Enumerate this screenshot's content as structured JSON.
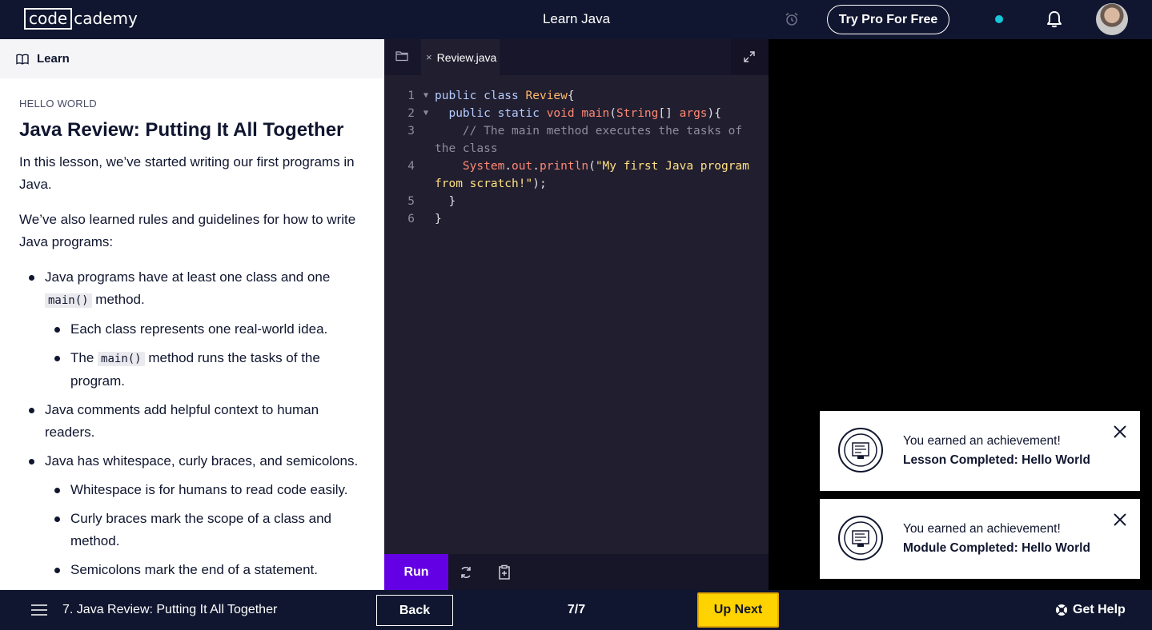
{
  "header": {
    "logo_left": "code",
    "logo_right": "cademy",
    "course_title": "Learn Java",
    "pro_button": "Try Pro For Free"
  },
  "learn": {
    "tab_label": "Learn",
    "eyebrow": "HELLO WORLD",
    "title": "Java Review: Putting It All Together",
    "para1": "In this lesson, we’ve started writing our first programs in Java.",
    "para2": "We’ve also learned rules and guidelines for how to write Java programs:",
    "b1_pre": "Java programs have at least one class and one ",
    "b1_code": "main()",
    "b1_post": " method.",
    "b1a": "Each class represents one real-world idea.",
    "b1b_pre": "The ",
    "b1b_code": "main()",
    "b1b_post": " method runs the tasks of the program.",
    "b2": "Java comments add helpful context to human readers.",
    "b3": "Java has whitespace, curly braces, and semicolons.",
    "b3a": "Whitespace is for humans to read code easily.",
    "b3b": "Curly braces mark the scope of a class and method.",
    "b3c": "Semicolons mark the end of a statement."
  },
  "editor": {
    "file_tab": "Review.java",
    "close_glyph": "×",
    "run_label": "Run",
    "line_numbers": [
      "1",
      "2",
      "3",
      "4",
      "5",
      "6"
    ]
  },
  "toasts": [
    {
      "line1": "You earned an achievement!",
      "line2": "Lesson Completed: Hello World"
    },
    {
      "line1": "You earned an achievement!",
      "line2": "Module Completed: Hello World"
    }
  ],
  "footer": {
    "lesson_name": "7. Java Review: Putting It All Together",
    "back_label": "Back",
    "progress": "7/7",
    "next_label": "Up Next",
    "help_label": "Get Help"
  },
  "colors": {
    "navy": "#10162f",
    "run_purple": "#6400e4",
    "next_yellow": "#ffd300",
    "status_dot": "#14c8d9"
  }
}
